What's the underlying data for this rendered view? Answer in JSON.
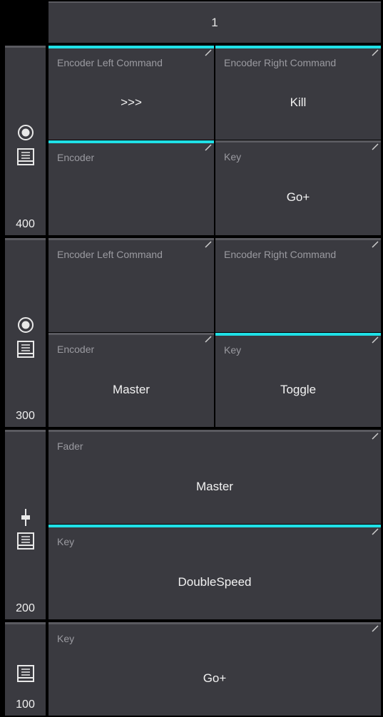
{
  "header": {
    "page_number": "1"
  },
  "sections": [
    {
      "number": "400",
      "icons": [
        "radio-target-icon",
        "executor-panel-icon"
      ],
      "cells": [
        {
          "label": "Encoder Left Command",
          "value": ">>>"
        },
        {
          "label": "Encoder Right Command",
          "value": "Kill"
        },
        {
          "label": "Encoder",
          "value": ""
        },
        {
          "label": "Key",
          "value": "Go+"
        }
      ]
    },
    {
      "number": "300",
      "icons": [
        "radio-target-icon",
        "executor-panel-icon"
      ],
      "cells": [
        {
          "label": "Encoder Left Command",
          "value": ""
        },
        {
          "label": "Encoder Right Command",
          "value": ""
        },
        {
          "label": "Encoder",
          "value": "Master"
        },
        {
          "label": "Key",
          "value": "Toggle"
        }
      ]
    },
    {
      "number": "200",
      "icons": [
        "fader-icon",
        "executor-panel-icon"
      ],
      "cells": [
        {
          "label": "Fader",
          "value": "Master"
        },
        {
          "label": "Key",
          "value": "DoubleSpeed"
        }
      ]
    },
    {
      "number": "100",
      "icons": [
        "executor-panel-icon"
      ],
      "cells": [
        {
          "label": "Key",
          "value": "Go+"
        }
      ]
    }
  ],
  "colors": {
    "highlight": "#1fe0e6",
    "panel": "#3a3a40",
    "background": "#000000"
  }
}
